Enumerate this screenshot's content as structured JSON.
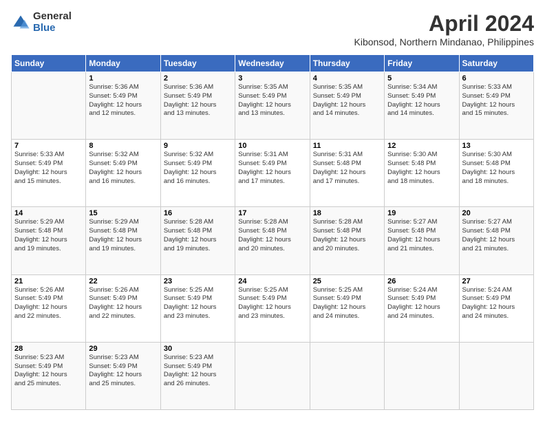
{
  "logo": {
    "general": "General",
    "blue": "Blue"
  },
  "header": {
    "title": "April 2024",
    "subtitle": "Kibonsod, Northern Mindanao, Philippines"
  },
  "calendar": {
    "headers": [
      "Sunday",
      "Monday",
      "Tuesday",
      "Wednesday",
      "Thursday",
      "Friday",
      "Saturday"
    ],
    "rows": [
      [
        {
          "day": "",
          "info": ""
        },
        {
          "day": "1",
          "info": "Sunrise: 5:36 AM\nSunset: 5:49 PM\nDaylight: 12 hours\nand 12 minutes."
        },
        {
          "day": "2",
          "info": "Sunrise: 5:36 AM\nSunset: 5:49 PM\nDaylight: 12 hours\nand 13 minutes."
        },
        {
          "day": "3",
          "info": "Sunrise: 5:35 AM\nSunset: 5:49 PM\nDaylight: 12 hours\nand 13 minutes."
        },
        {
          "day": "4",
          "info": "Sunrise: 5:35 AM\nSunset: 5:49 PM\nDaylight: 12 hours\nand 14 minutes."
        },
        {
          "day": "5",
          "info": "Sunrise: 5:34 AM\nSunset: 5:49 PM\nDaylight: 12 hours\nand 14 minutes."
        },
        {
          "day": "6",
          "info": "Sunrise: 5:33 AM\nSunset: 5:49 PM\nDaylight: 12 hours\nand 15 minutes."
        }
      ],
      [
        {
          "day": "7",
          "info": "Sunrise: 5:33 AM\nSunset: 5:49 PM\nDaylight: 12 hours\nand 15 minutes."
        },
        {
          "day": "8",
          "info": "Sunrise: 5:32 AM\nSunset: 5:49 PM\nDaylight: 12 hours\nand 16 minutes."
        },
        {
          "day": "9",
          "info": "Sunrise: 5:32 AM\nSunset: 5:49 PM\nDaylight: 12 hours\nand 16 minutes."
        },
        {
          "day": "10",
          "info": "Sunrise: 5:31 AM\nSunset: 5:49 PM\nDaylight: 12 hours\nand 17 minutes."
        },
        {
          "day": "11",
          "info": "Sunrise: 5:31 AM\nSunset: 5:48 PM\nDaylight: 12 hours\nand 17 minutes."
        },
        {
          "day": "12",
          "info": "Sunrise: 5:30 AM\nSunset: 5:48 PM\nDaylight: 12 hours\nand 18 minutes."
        },
        {
          "day": "13",
          "info": "Sunrise: 5:30 AM\nSunset: 5:48 PM\nDaylight: 12 hours\nand 18 minutes."
        }
      ],
      [
        {
          "day": "14",
          "info": "Sunrise: 5:29 AM\nSunset: 5:48 PM\nDaylight: 12 hours\nand 19 minutes."
        },
        {
          "day": "15",
          "info": "Sunrise: 5:29 AM\nSunset: 5:48 PM\nDaylight: 12 hours\nand 19 minutes."
        },
        {
          "day": "16",
          "info": "Sunrise: 5:28 AM\nSunset: 5:48 PM\nDaylight: 12 hours\nand 19 minutes."
        },
        {
          "day": "17",
          "info": "Sunrise: 5:28 AM\nSunset: 5:48 PM\nDaylight: 12 hours\nand 20 minutes."
        },
        {
          "day": "18",
          "info": "Sunrise: 5:28 AM\nSunset: 5:48 PM\nDaylight: 12 hours\nand 20 minutes."
        },
        {
          "day": "19",
          "info": "Sunrise: 5:27 AM\nSunset: 5:48 PM\nDaylight: 12 hours\nand 21 minutes."
        },
        {
          "day": "20",
          "info": "Sunrise: 5:27 AM\nSunset: 5:48 PM\nDaylight: 12 hours\nand 21 minutes."
        }
      ],
      [
        {
          "day": "21",
          "info": "Sunrise: 5:26 AM\nSunset: 5:49 PM\nDaylight: 12 hours\nand 22 minutes."
        },
        {
          "day": "22",
          "info": "Sunrise: 5:26 AM\nSunset: 5:49 PM\nDaylight: 12 hours\nand 22 minutes."
        },
        {
          "day": "23",
          "info": "Sunrise: 5:25 AM\nSunset: 5:49 PM\nDaylight: 12 hours\nand 23 minutes."
        },
        {
          "day": "24",
          "info": "Sunrise: 5:25 AM\nSunset: 5:49 PM\nDaylight: 12 hours\nand 23 minutes."
        },
        {
          "day": "25",
          "info": "Sunrise: 5:25 AM\nSunset: 5:49 PM\nDaylight: 12 hours\nand 24 minutes."
        },
        {
          "day": "26",
          "info": "Sunrise: 5:24 AM\nSunset: 5:49 PM\nDaylight: 12 hours\nand 24 minutes."
        },
        {
          "day": "27",
          "info": "Sunrise: 5:24 AM\nSunset: 5:49 PM\nDaylight: 12 hours\nand 24 minutes."
        }
      ],
      [
        {
          "day": "28",
          "info": "Sunrise: 5:23 AM\nSunset: 5:49 PM\nDaylight: 12 hours\nand 25 minutes."
        },
        {
          "day": "29",
          "info": "Sunrise: 5:23 AM\nSunset: 5:49 PM\nDaylight: 12 hours\nand 25 minutes."
        },
        {
          "day": "30",
          "info": "Sunrise: 5:23 AM\nSunset: 5:49 PM\nDaylight: 12 hours\nand 26 minutes."
        },
        {
          "day": "",
          "info": ""
        },
        {
          "day": "",
          "info": ""
        },
        {
          "day": "",
          "info": ""
        },
        {
          "day": "",
          "info": ""
        }
      ]
    ]
  }
}
